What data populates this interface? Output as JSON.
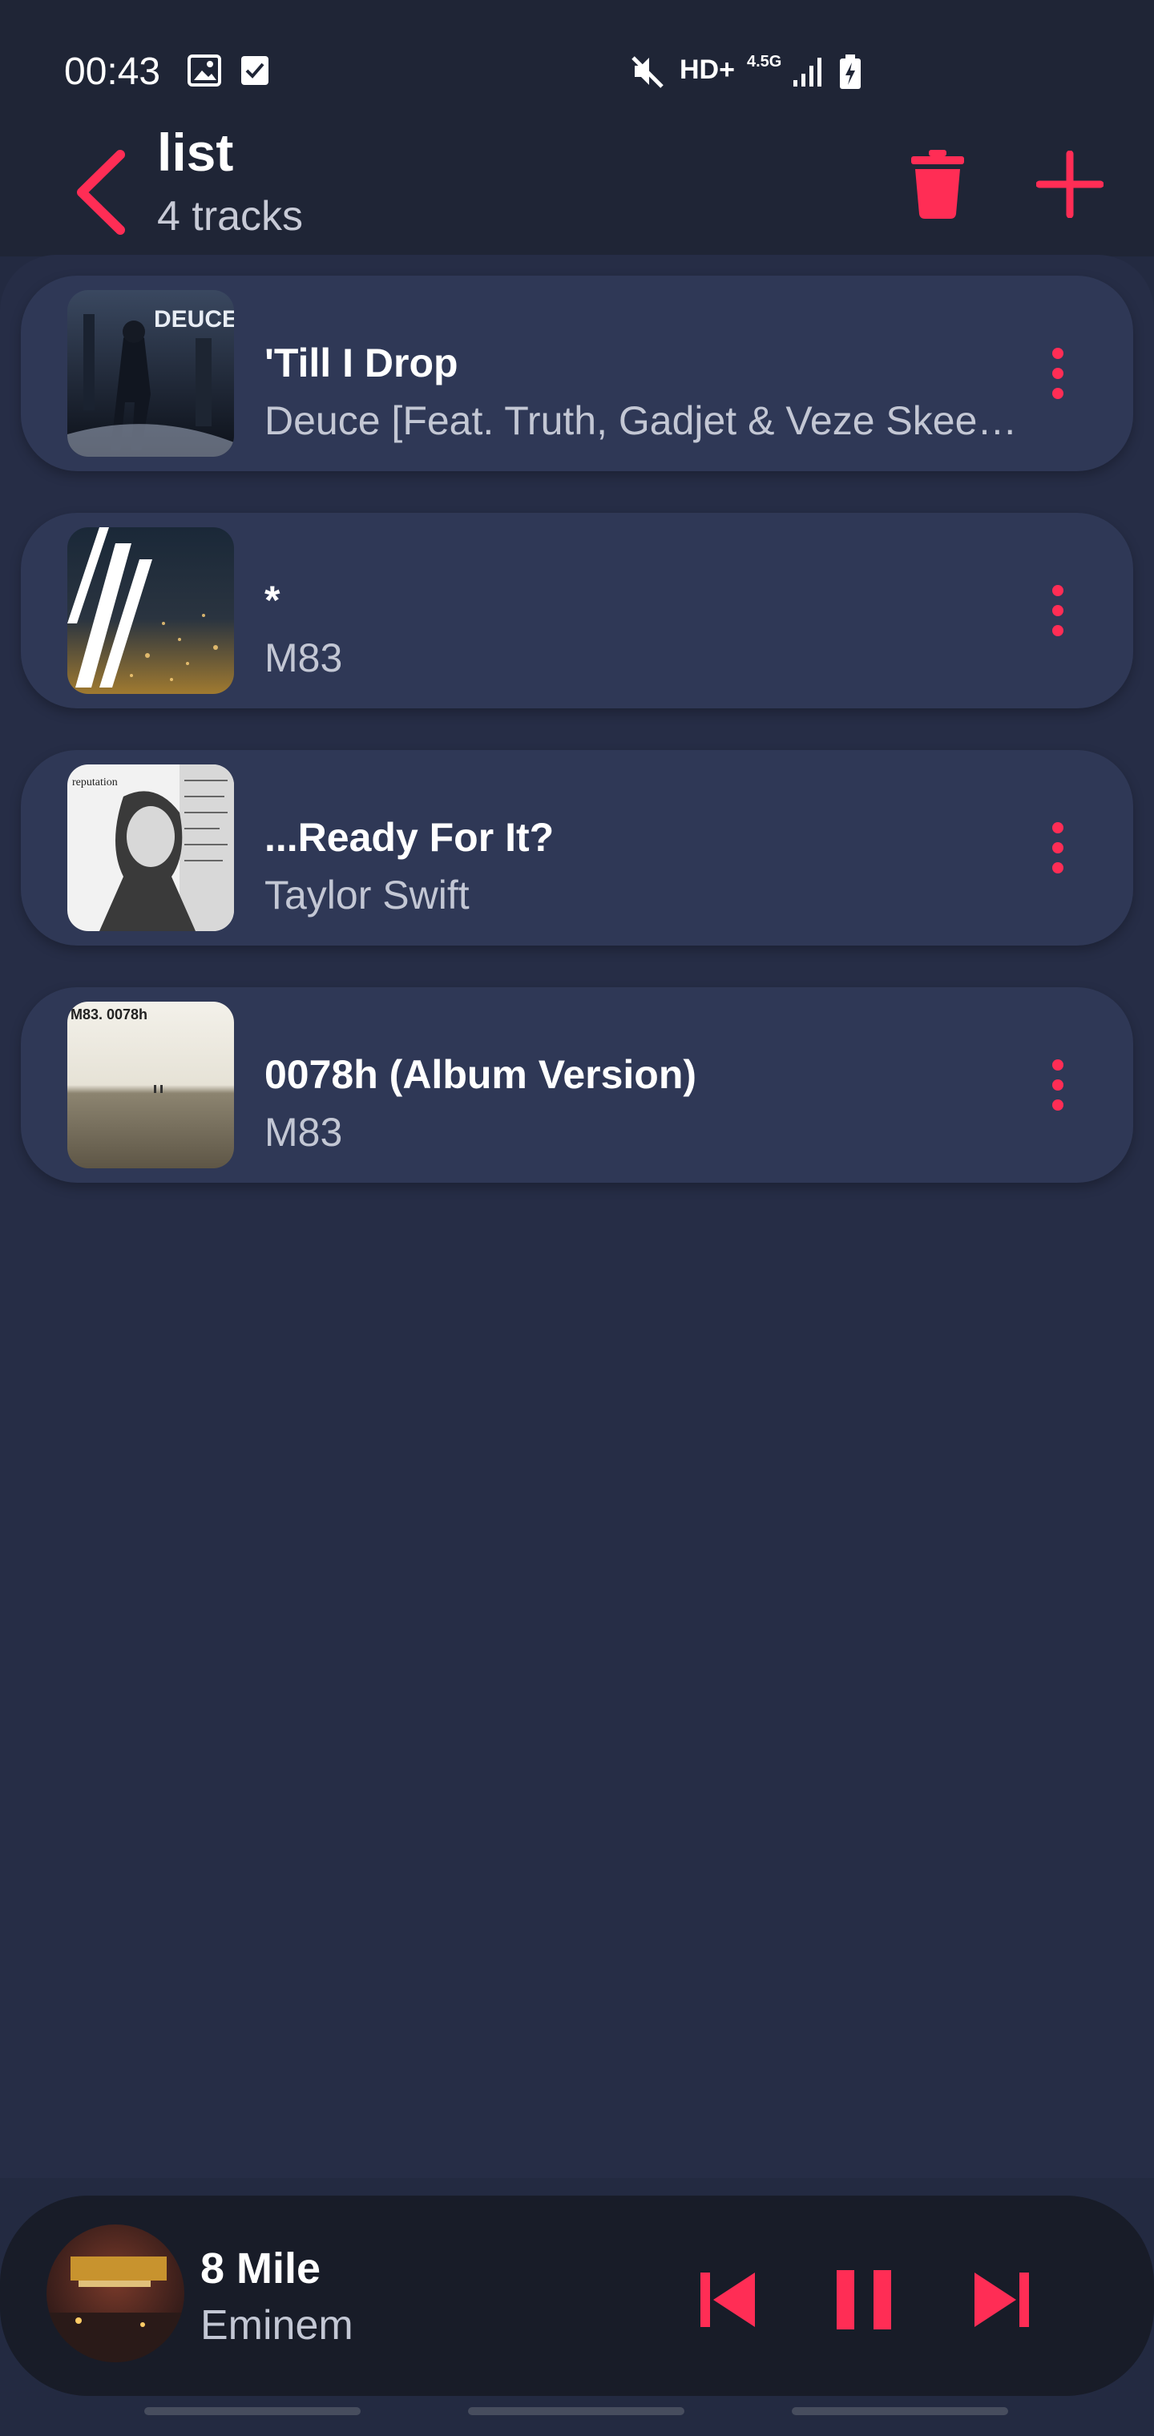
{
  "status_bar": {
    "time": "00:43",
    "network_label": "HD+",
    "network_gen": "4.5G",
    "icons": [
      "image-icon",
      "check-square-icon",
      "mute-icon",
      "signal-icon",
      "battery-charging-icon"
    ]
  },
  "header": {
    "title": "list",
    "subtitle": "4 tracks"
  },
  "tracks": [
    {
      "title": "'Till I Drop",
      "artist": "Deuce [Feat. Truth, Gadjet & Veze Skeeze]",
      "cover_text": "DEUCE"
    },
    {
      "title": "*",
      "artist": "M83",
      "cover_text": ""
    },
    {
      "title": "...Ready For It?",
      "artist": "Taylor Swift",
      "cover_text": "reputation"
    },
    {
      "title": "0078h (Album Version)",
      "artist": "M83",
      "cover_text": "M83. 0078h"
    }
  ],
  "now_playing": {
    "title": "8 Mile",
    "artist": "Eminem"
  },
  "colors": {
    "accent": "#ff2d55",
    "background": "#232a41",
    "card": "#2f3856",
    "player": "#181c28"
  }
}
